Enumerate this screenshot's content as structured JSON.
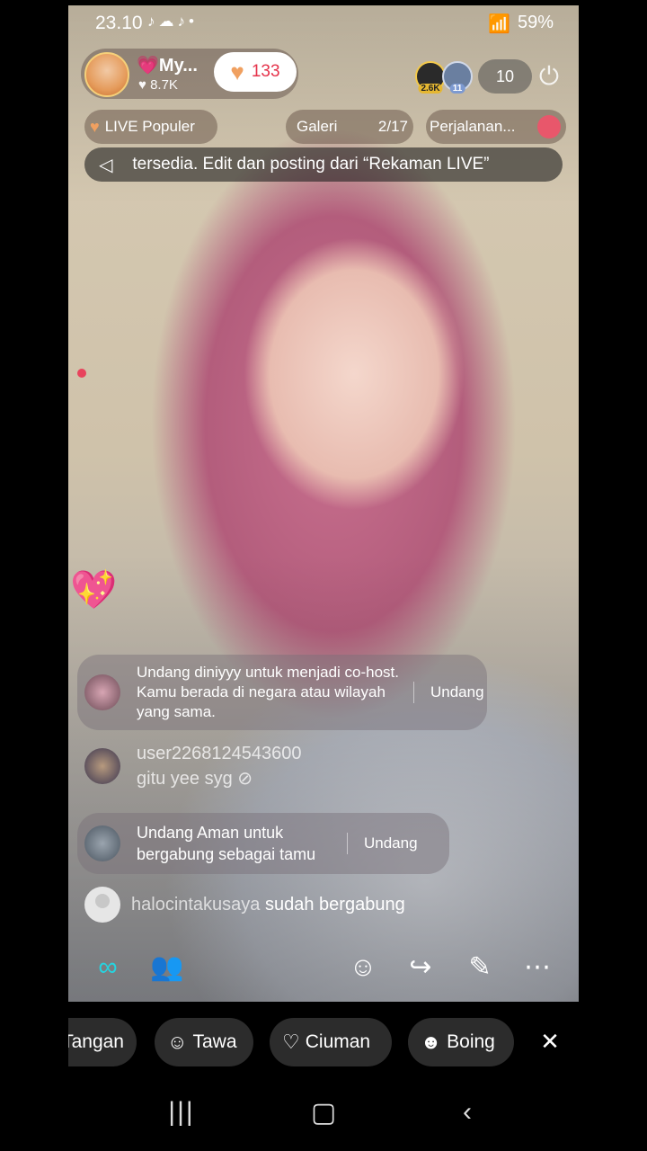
{
  "status": {
    "time": "23.10",
    "battery": "59%"
  },
  "host": {
    "name": "💗My...",
    "likes": "♥ 8.7K"
  },
  "like_pill": {
    "count": "133"
  },
  "viewers": {
    "badge1": "2.6K",
    "badge2": "11",
    "count": "10"
  },
  "chips": {
    "popular": "LIVE Populer",
    "gallery_label": "Galeri",
    "gallery_count": "2/17",
    "trip": "Perjalanan..."
  },
  "banner": {
    "text": "tersedia. Edit dan posting dari “Rekaman LIVE”"
  },
  "comments": {
    "c1": {
      "text": "Undang diniyyy untuk menjadi co-host. Kamu berada di negara atau wilayah yang sama.",
      "action": "Undang"
    },
    "c2": {
      "user": "user2268124543600",
      "message": "gitu yee syg"
    },
    "c3": {
      "text": "Undang Aman untuk bergabung sebagai tamu",
      "action": "Undang"
    },
    "c4": {
      "user": "halocintakusaya",
      "message": "sudah bergabung"
    }
  },
  "reactions": [
    {
      "label": "Tangan"
    },
    {
      "label": "Tawa"
    },
    {
      "label": "Ciuman"
    },
    {
      "label": "Boing"
    }
  ],
  "icons": {
    "power": "power-icon",
    "megaphone": "megaphone-icon",
    "link": "link-icon",
    "people": "people-icon",
    "chat": "chat-icon",
    "share": "share-icon",
    "wand": "magic-wand-icon",
    "more": "more-icon",
    "close": "close-icon"
  },
  "colors": {
    "accent_link": "#25d4e0",
    "accent_people": "#f25a8a",
    "like_text": "#e5334b"
  }
}
